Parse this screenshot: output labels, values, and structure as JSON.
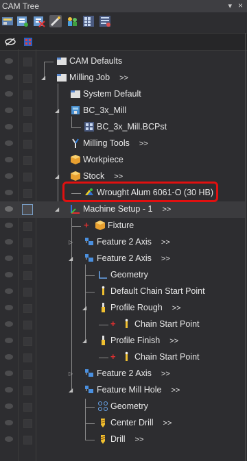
{
  "window": {
    "title": "CAM Tree",
    "pin_glyph": "▾",
    "close_glyph": "×"
  },
  "toolbar": {
    "buttons": [
      "machine-icon",
      "operations-icon",
      "toolpath-icon",
      "tools-icon",
      "people-icon",
      "grid-icon",
      "settings-icon"
    ]
  },
  "header": {
    "col1_icon": "visibility-icon",
    "col2_icon": "select-icon"
  },
  "tree": {
    "expand_arrow": ">>",
    "nodes": [
      {
        "label": "CAM Defaults",
        "arrow": "",
        "icon": "folder-icon"
      },
      {
        "label": "Milling Job",
        "arrow": ">>",
        "icon": "folder-icon"
      },
      {
        "label": "System Default",
        "arrow": "",
        "icon": "folder-icon"
      },
      {
        "label": "BC_3x_Mill",
        "arrow": "",
        "icon": "machine-icon"
      },
      {
        "label": "BC_3x_Mill.BCPst",
        "arrow": "",
        "icon": "post-icon"
      },
      {
        "label": "Milling Tools",
        "arrow": ">>",
        "icon": "tools-icon"
      },
      {
        "label": "Workpiece",
        "arrow": "",
        "icon": "box-icon"
      },
      {
        "label": "Stock",
        "arrow": ">>",
        "icon": "box-icon"
      },
      {
        "label": "Wrought Alum 6061-O (30 HB)",
        "arrow": "",
        "icon": "material-icon"
      },
      {
        "label": "Machine Setup - 1",
        "arrow": ">>",
        "icon": "axis-icon"
      },
      {
        "label": "Fixture",
        "arrow": "",
        "icon": "box-icon"
      },
      {
        "label": "Feature 2 Axis",
        "arrow": ">>",
        "icon": "feature-icon"
      },
      {
        "label": "Feature 2 Axis",
        "arrow": ">>",
        "icon": "feature-icon"
      },
      {
        "label": "Geometry",
        "arrow": "",
        "icon": "geometry-icon"
      },
      {
        "label": "Default Chain Start Point",
        "arrow": "",
        "icon": "start-point-icon"
      },
      {
        "label": "Profile Rough",
        "arrow": ">>",
        "icon": "endmill-icon"
      },
      {
        "label": "Chain Start Point",
        "arrow": "",
        "icon": "start-point-icon"
      },
      {
        "label": "Profile Finish",
        "arrow": ">>",
        "icon": "endmill-icon"
      },
      {
        "label": "Chain Start Point",
        "arrow": "",
        "icon": "start-point-icon"
      },
      {
        "label": "Feature 2 Axis",
        "arrow": ">>",
        "icon": "feature-icon"
      },
      {
        "label": "Feature Mill Hole",
        "arrow": ">>",
        "icon": "feature-icon"
      },
      {
        "label": "Geometry",
        "arrow": "",
        "icon": "hole-geometry-icon"
      },
      {
        "label": "Center Drill",
        "arrow": ">>",
        "icon": "drill-icon"
      },
      {
        "label": "Drill",
        "arrow": ">>",
        "icon": "drill-icon"
      }
    ]
  },
  "colors": {
    "highlight": "#e01010",
    "background": "#2d2d30",
    "selection": "#3b3b3e"
  }
}
